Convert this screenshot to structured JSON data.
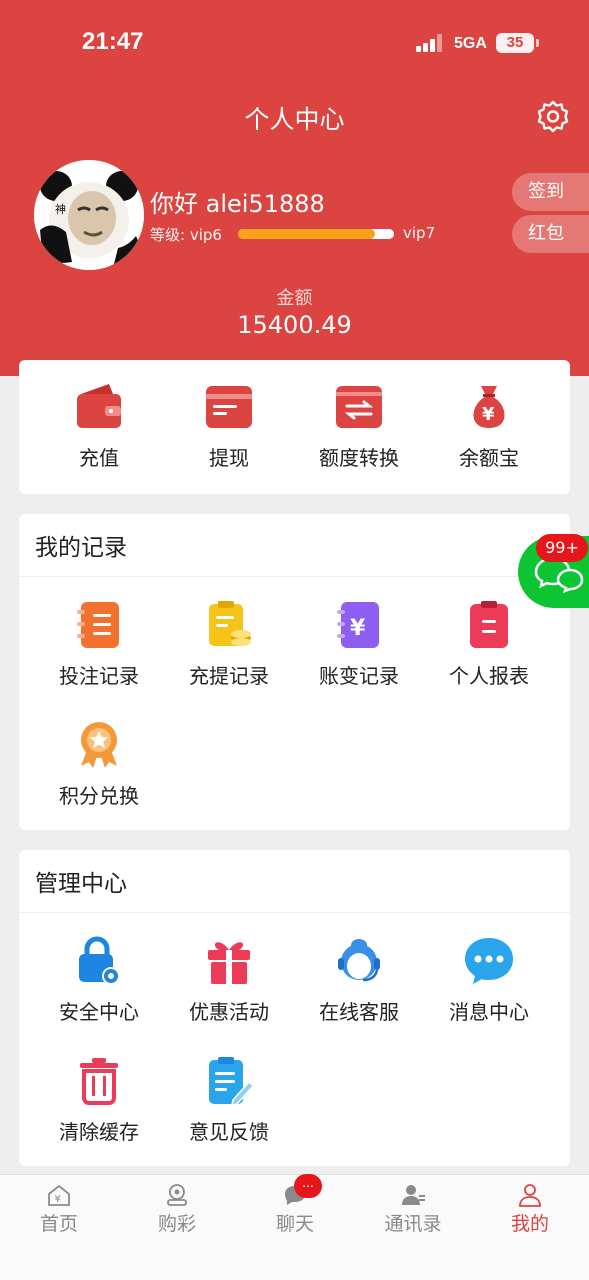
{
  "status_bar": {
    "time": "21:47",
    "network": "5GA",
    "battery": "35"
  },
  "header": {
    "title": "个人中心",
    "greeting": "你好 alei51888",
    "level_label": "等级: vip6",
    "level_next": "vip7",
    "level_progress_percent": 88,
    "sign_in_label": "签到",
    "red_packet_label": "红包",
    "amount_label": "金额",
    "amount_value": "15400.49",
    "avatar_icon": "panda-meme-avatar",
    "settings_icon": "gear-icon"
  },
  "quick_actions": [
    {
      "label": "充值",
      "icon": "wallet-icon"
    },
    {
      "label": "提现",
      "icon": "card-icon"
    },
    {
      "label": "额度转换",
      "icon": "transfer-icon"
    },
    {
      "label": "余额宝",
      "icon": "money-bag-icon"
    }
  ],
  "records": {
    "title": "我的记录",
    "items": [
      {
        "label": "投注记录",
        "icon": "notebook-icon"
      },
      {
        "label": "充提记录",
        "icon": "clipboard-coins-icon"
      },
      {
        "label": "账变记录",
        "icon": "yen-book-icon"
      },
      {
        "label": "个人报表",
        "icon": "report-icon"
      },
      {
        "label": "积分兑换",
        "icon": "medal-icon"
      }
    ]
  },
  "management": {
    "title": "管理中心",
    "items": [
      {
        "label": "安全中心",
        "icon": "lock-gear-icon"
      },
      {
        "label": "优惠活动",
        "icon": "gift-icon"
      },
      {
        "label": "在线客服",
        "icon": "customer-service-icon"
      },
      {
        "label": "消息中心",
        "icon": "chat-bubble-icon"
      },
      {
        "label": "清除缓存",
        "icon": "trash-icon"
      },
      {
        "label": "意见反馈",
        "icon": "feedback-icon"
      }
    ]
  },
  "float_chat": {
    "badge": "99+"
  },
  "tabbar": {
    "chat_badge": "...",
    "items": [
      {
        "label": "首页",
        "icon": "home-icon"
      },
      {
        "label": "购彩",
        "icon": "lottery-icon"
      },
      {
        "label": "聊天",
        "icon": "chat-icon"
      },
      {
        "label": "通讯录",
        "icon": "contacts-icon"
      },
      {
        "label": "我的",
        "icon": "profile-icon"
      }
    ],
    "active_index": 4
  },
  "colors": {
    "brand_red": "#dc4441",
    "progress_orange": "#f7a21b",
    "float_green": "#0dc532",
    "badge_red": "#e5171a"
  }
}
